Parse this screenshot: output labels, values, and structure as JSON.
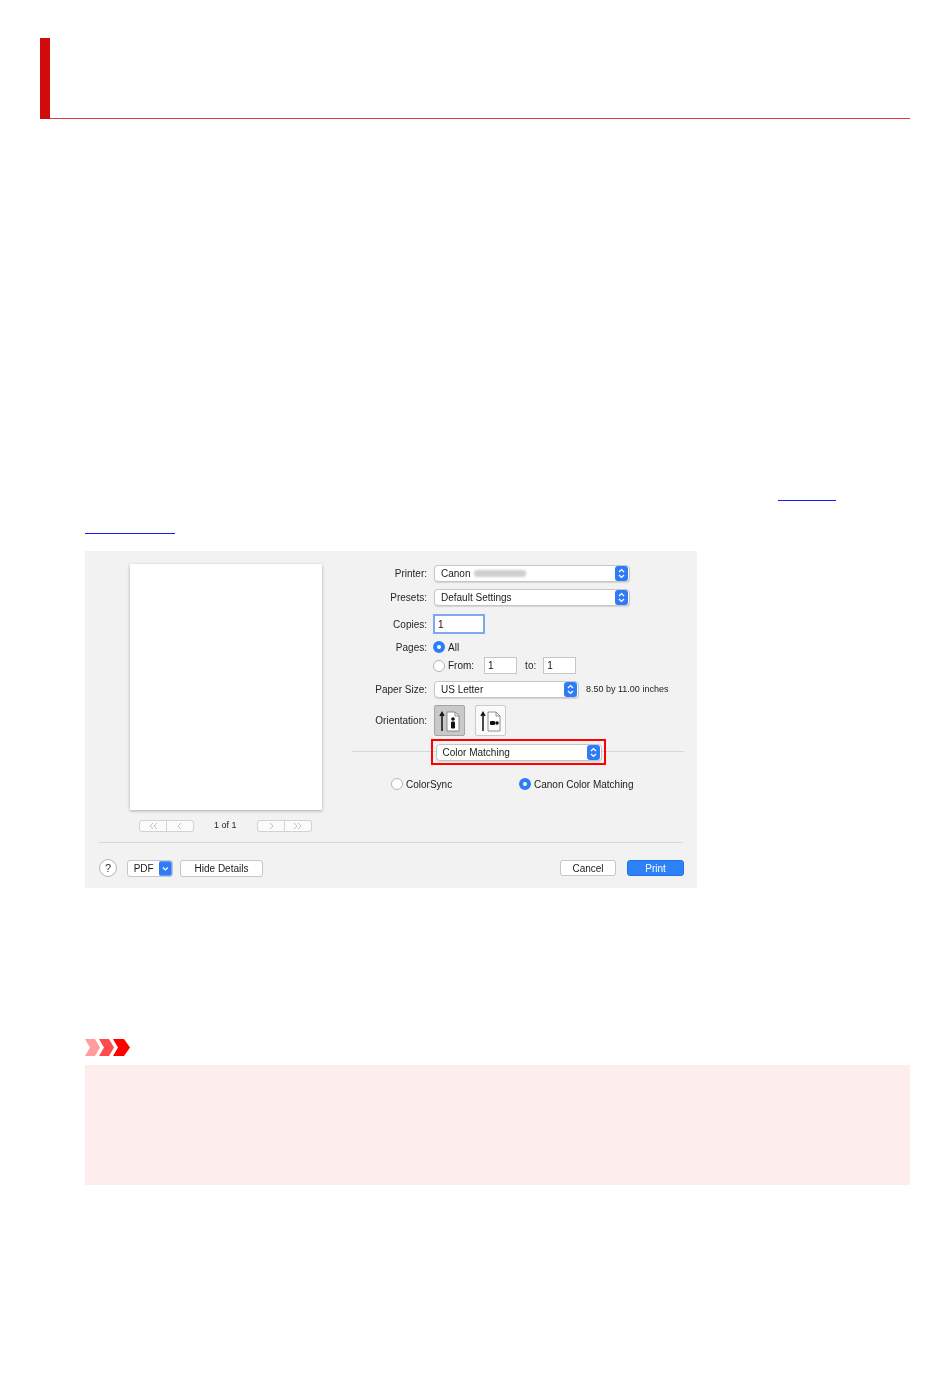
{
  "print_dialog": {
    "preview": {
      "nav": [
        {
          "kind": "first",
          "disabled": true
        },
        {
          "kind": "previous",
          "disabled": true
        },
        {
          "kind": "next",
          "disabled": true
        },
        {
          "kind": "last",
          "disabled": true
        }
      ],
      "page_counter": "1 of 1"
    },
    "printer": {
      "label": "Printer:",
      "value": "Canon",
      "redacted_model": true
    },
    "presets": {
      "label": "Presets:",
      "value": "Default Settings"
    },
    "copies": {
      "label": "Copies:",
      "value": "1",
      "focused": true
    },
    "pages": {
      "label": "Pages:",
      "options": [
        {
          "kind": "all",
          "label": "All",
          "selected": true
        },
        {
          "kind": "range",
          "label": "From:",
          "selected": false,
          "from": "1",
          "to_label": "to:",
          "to": "1"
        }
      ]
    },
    "paper_size": {
      "label": "Paper Size:",
      "value": "US Letter",
      "dimensions": "8.50 by 11.00 inches"
    },
    "orientation": {
      "label": "Orientation:",
      "options": [
        {
          "kind": "portrait",
          "selected": true
        },
        {
          "kind": "landscape",
          "selected": false
        }
      ]
    },
    "section_menu": {
      "value": "Color Matching",
      "highlighted": true
    },
    "color_matching": [
      {
        "label": "ColorSync",
        "selected": false
      },
      {
        "label": "Canon Color Matching",
        "selected": true
      }
    ],
    "footer": {
      "help": "?",
      "pdf": "PDF",
      "hide_details": "Hide Details",
      "cancel": "Cancel",
      "print": "Print"
    }
  }
}
